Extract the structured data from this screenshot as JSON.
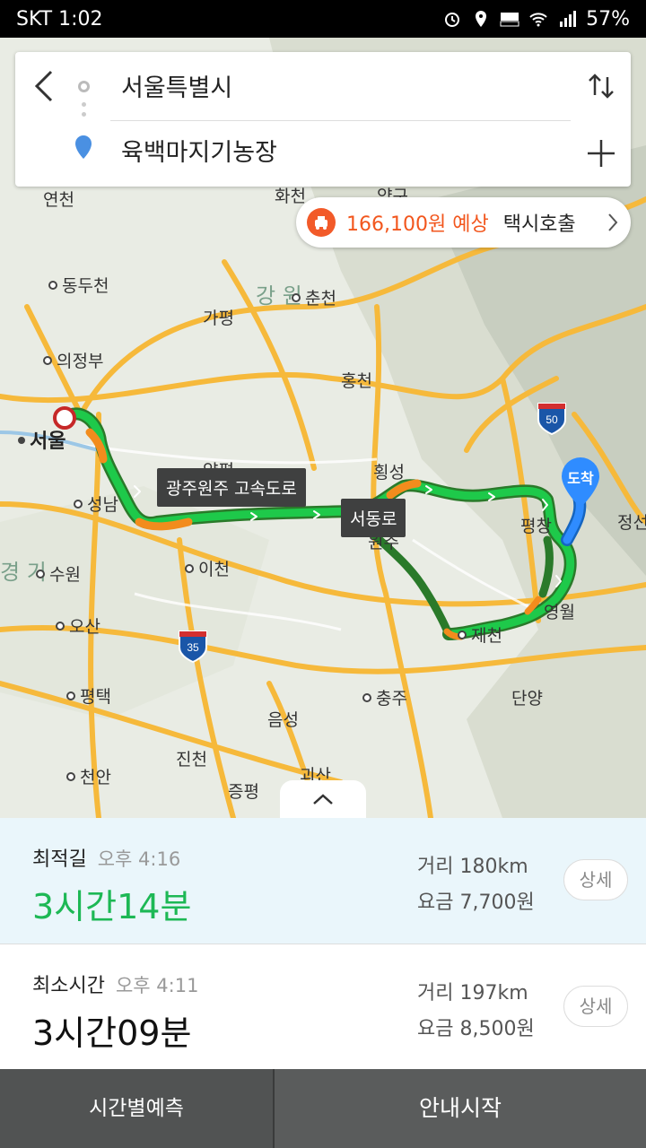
{
  "status_bar": {
    "carrier": "SKT",
    "time": "1:02",
    "battery": "57%"
  },
  "search": {
    "origin": "서울특별시",
    "destination": "육백마지기농장"
  },
  "taxi": {
    "price": "166,100원 예상",
    "call": "택시호출"
  },
  "map": {
    "labels": {
      "yeoncheon": "연천",
      "hwacheon": "화천",
      "yanggu": "양구",
      "dongducheon": "동두천",
      "chuncheon": "춘천",
      "gapyeong": "가평",
      "uijeongbu": "의정부",
      "hongcheon": "홍천",
      "seoul": "서울",
      "seongnam": "성남",
      "yangpyeong": "양평",
      "hoengseong": "횡성",
      "suwon": "수원",
      "icheon": "이천",
      "wonju": "원주",
      "pyeongchang": "평창",
      "jeongseon": "정선",
      "osan": "오산",
      "yeongwol": "영월",
      "jecheon": "제천",
      "pyeongtaek": "평택",
      "chungju": "충주",
      "danyang": "단양",
      "eumseong": "음성",
      "jincheon": "진천",
      "cheonan": "천안",
      "goesan": "괴산",
      "jeungpyeong": "증평",
      "gangwon": "강 원",
      "gyeonggi": "경 기"
    },
    "route_tags": {
      "expressway": "광주원주 고속도로",
      "seodongro": "서동로"
    },
    "destination_badge": "도착",
    "highway_shields": [
      "50",
      "35"
    ]
  },
  "routes": [
    {
      "name": "최적길",
      "eta": "오후 4:16",
      "duration": "3시간14분",
      "distance": "거리 180km",
      "fee": "요금 7,700원",
      "detail": "상세"
    },
    {
      "name": "최소시간",
      "eta": "오후 4:11",
      "duration": "3시간09분",
      "distance": "거리 197km",
      "fee": "요금 8,500원",
      "detail": "상세"
    }
  ],
  "bottom": {
    "forecast": "시간별예측",
    "start": "안내시작"
  }
}
